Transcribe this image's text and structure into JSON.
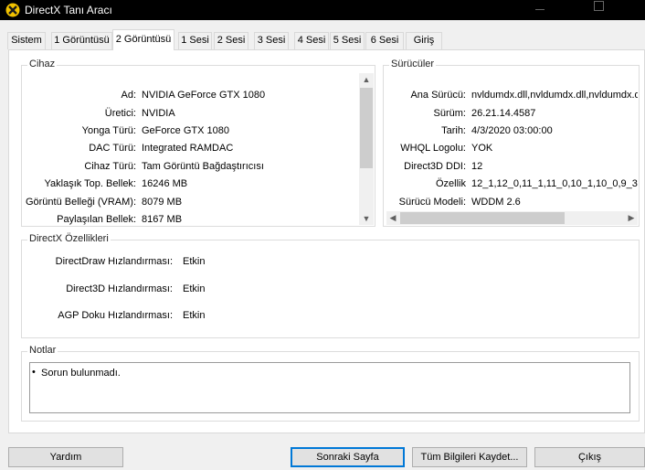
{
  "window": {
    "title": "DirectX Tanı Aracı",
    "icon": "directx-x-icon",
    "controls": [
      "minimize-icon",
      "maximize-icon",
      "close-icon"
    ]
  },
  "tabs": [
    {
      "label": "Sistem"
    },
    {
      "label": "1 Görüntüsü"
    },
    {
      "label": "2 Görüntüsü",
      "active": true
    },
    {
      "label": "1 Sesi"
    },
    {
      "label": "2 Sesi"
    },
    {
      "label": "3 Sesi"
    },
    {
      "label": "4 Sesi"
    },
    {
      "label": "5 Sesi"
    },
    {
      "label": "6 Sesi"
    },
    {
      "label": "Giriş"
    }
  ],
  "device": {
    "label": "Cihaz",
    "rows": [
      {
        "key": "Ad:",
        "value": "NVIDIA GeForce GTX 1080"
      },
      {
        "key": "Üretici:",
        "value": "NVIDIA"
      },
      {
        "key": "Yonga Türü:",
        "value": "GeForce GTX 1080"
      },
      {
        "key": "DAC Türü:",
        "value": "Integrated RAMDAC"
      },
      {
        "key": "Cihaz Türü:",
        "value": "Tam Görüntü Bağdaştırıcısı"
      },
      {
        "key": "Yaklaşık Top. Bellek:",
        "value": "16246 MB"
      },
      {
        "key": "Görüntü Belleği (VRAM):",
        "value": "8079 MB"
      },
      {
        "key": "Paylaşılan Bellek:",
        "value": "8167 MB"
      }
    ]
  },
  "drivers": {
    "label": "Sürücüler",
    "rows": [
      {
        "key": "Ana Sürücü:",
        "value": "nvldumdx.dll,nvldumdx.dll,nvldumdx.dll"
      },
      {
        "key": "Sürüm:",
        "value": "26.21.14.4587"
      },
      {
        "key": "Tarih:",
        "value": "4/3/2020 03:00:00"
      },
      {
        "key": "WHQL Logolu:",
        "value": "YOK"
      },
      {
        "key": "Direct3D DDI:",
        "value": "12"
      },
      {
        "key": "Özellik",
        "value": "12_1,12_0,11_1,11_0,10_1,10_0,9_3"
      },
      {
        "key": "Sürücü Modeli:",
        "value": "WDDM 2.6"
      }
    ]
  },
  "features": {
    "label": "DirectX Özellikleri",
    "rows": [
      {
        "key": "DirectDraw Hızlandırması:",
        "value": "Etkin"
      },
      {
        "key": "Direct3D Hızlandırması:",
        "value": "Etkin"
      },
      {
        "key": "AGP Doku Hızlandırması:",
        "value": "Etkin"
      }
    ]
  },
  "notes": {
    "label": "Notlar",
    "bullet": "•",
    "items": [
      "Sorun bulunmadı."
    ]
  },
  "buttons": {
    "help": "Yardım",
    "next_page": "Sonraki Sayfa",
    "save_all": "Tüm Bilgileri Kaydet...",
    "exit": "Çıkış"
  }
}
